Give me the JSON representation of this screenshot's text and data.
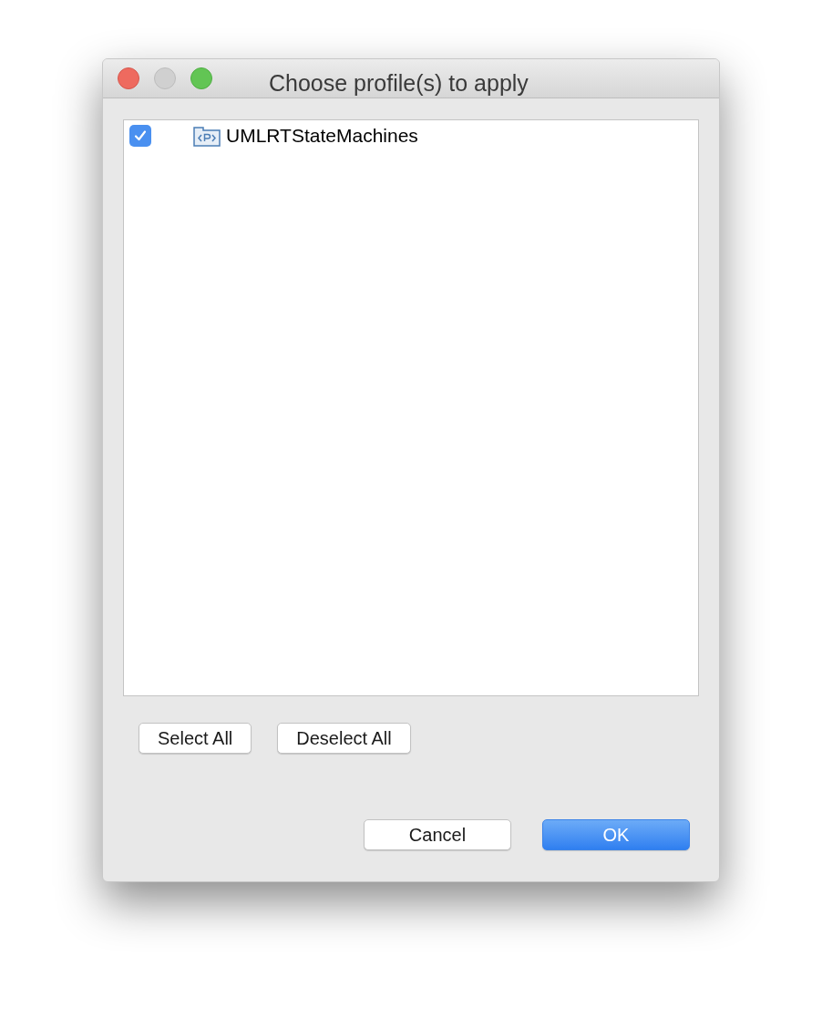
{
  "window": {
    "title": "Choose profile(s) to apply"
  },
  "profiles": [
    {
      "label": "UMLRTStateMachines",
      "checked": true
    }
  ],
  "selection_buttons": [
    "Select All",
    "Deselect All"
  ],
  "dialog_buttons": [
    {
      "label": "Cancel",
      "default": false
    },
    {
      "label": "OK",
      "default": true
    }
  ]
}
